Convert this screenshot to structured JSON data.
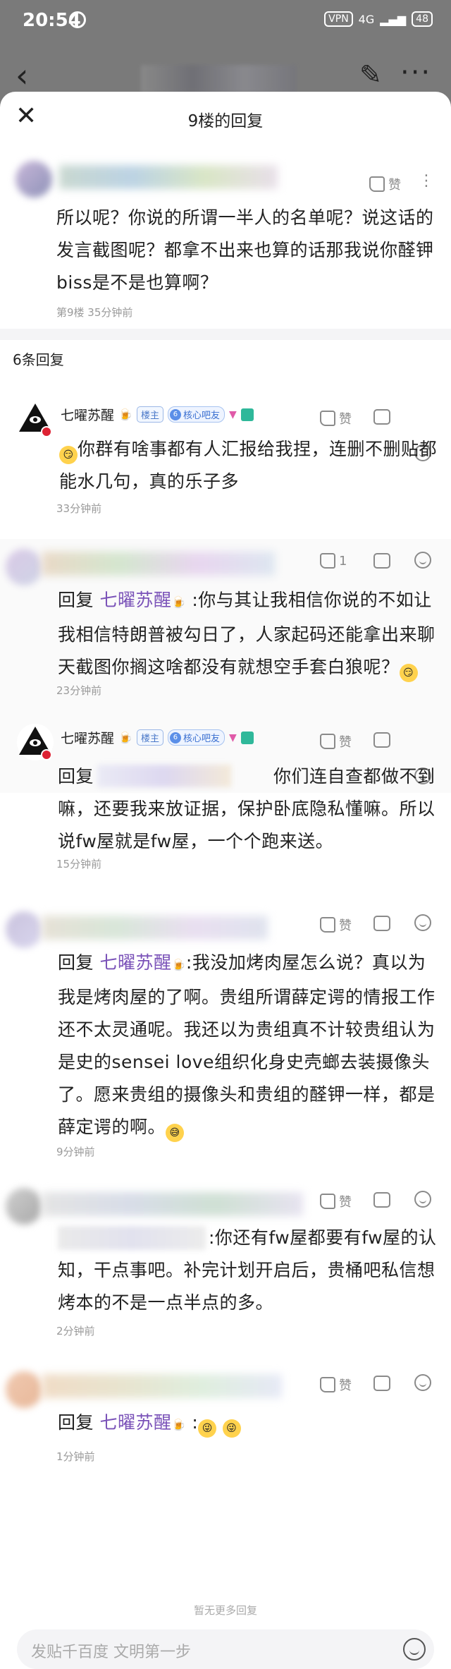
{
  "status": {
    "time": "20:54",
    "vpn": "VPN",
    "signal": "4G",
    "battery": "48"
  },
  "sheet": {
    "title": "9楼的回复"
  },
  "main_post": {
    "like_label": "赞",
    "text": "所以呢？你说的所谓一半人的名单呢？说这话的发言截图呢？都拿不出来也算的话那我说你醛钾biss是不是也算啊？",
    "meta": "第9楼   35分钟前"
  },
  "reply_count": "6条回复",
  "replies": [
    {
      "name": "七曜苏醒",
      "badge_master": "楼主",
      "badge_level": "6",
      "badge_core": "核心吧友",
      "like": "赞",
      "text": "你群有啥事都有人汇报给我捏，连删不删贴都能水几句，真的乐子多",
      "time": "33分钟前"
    },
    {
      "like": "1",
      "prefix": "回复 ",
      "target": "七曜苏醒",
      "text": " :你与其让我相信你说的不如让我相信特朗普被勾日了，人家起码还能拿出来聊天截图你搁这啥都没有就想空手套白狼呢？",
      "time": "23分钟前"
    },
    {
      "name": "七曜苏醒",
      "badge_master": "楼主",
      "badge_level": "6",
      "badge_core": "核心吧友",
      "like": "赞",
      "prefix": "回复",
      "text": "你们连自查都做不到嘛，还要我来放证据，保护卧底隐私懂嘛。所以说fw屋就是fw屋，一个个跑来送。",
      "time": "15分钟前"
    },
    {
      "like": "赞",
      "prefix": "回复 ",
      "target": "七曜苏醒",
      "text": ":我没加烤肉屋怎么说？真以为我是烤肉屋的了啊。贵组所谓薛定谔的情报工作还不太灵通呢。我还以为贵组真不计较贵组认为是史的sensei love组织化身史壳螂去装摄像头了。愿来贵组的摄像头和贵组的醛钾一样，都是薛定谔的啊。",
      "time": "9分钟前"
    },
    {
      "like": "赞",
      "text": ":你还有fw屋都要有fw屋的认知，干点事吧。补完计划开启后，贵桶吧私信想烤本的不是一点半点的多。",
      "time": "2分钟前"
    },
    {
      "like": "赞",
      "prefix": "回复 ",
      "target": "七曜苏醒",
      "text": " :",
      "time": "1分钟前"
    }
  ],
  "footer_note": "暂无更多回复",
  "input": {
    "placeholder": "发贴千百度 文明第一步"
  }
}
